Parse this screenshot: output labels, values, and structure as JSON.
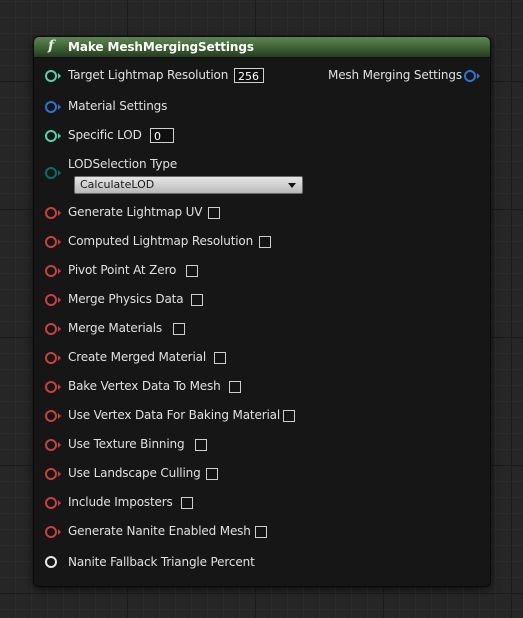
{
  "node": {
    "title": "Make MeshMergingSettings",
    "header_color": "#3d6034",
    "function_icon": "f"
  },
  "colors": {
    "int_pin": "#4fd6a8",
    "struct_pin": "#2d74d6",
    "byte_pin": "#0e6e63",
    "bool_pin": "#b23b3b",
    "float_pin": "#e8e8e8"
  },
  "inputs": {
    "target_lightmap_resolution": {
      "label": "Target Lightmap Resolution",
      "value": "256"
    },
    "material_settings": {
      "label": "Material Settings"
    },
    "specific_lod": {
      "label": "Specific LOD",
      "value": "0"
    },
    "lod_selection_type": {
      "label": "LODSelection Type",
      "selected": "CalculateLOD"
    },
    "bools": [
      {
        "label": "Generate Lightmap UV",
        "checked": false
      },
      {
        "label": "Computed Lightmap Resolution",
        "checked": false
      },
      {
        "label": "Pivot Point At Zero",
        "checked": false
      },
      {
        "label": "Merge Physics Data",
        "checked": false
      },
      {
        "label": "Merge Materials",
        "checked": false
      },
      {
        "label": "Create Merged Material",
        "checked": false
      },
      {
        "label": "Bake Vertex Data To Mesh",
        "checked": false
      },
      {
        "label": "Use Vertex Data For Baking Material",
        "checked": false
      },
      {
        "label": "Use Texture Binning",
        "checked": false
      },
      {
        "label": "Use Landscape Culling",
        "checked": false
      },
      {
        "label": "Include Imposters",
        "checked": false
      },
      {
        "label": "Generate Nanite Enabled Mesh",
        "checked": false
      }
    ],
    "nanite_fallback": {
      "label": "Nanite Fallback Triangle Percent"
    }
  },
  "outputs": {
    "mesh_merging_settings": {
      "label": "Mesh Merging Settings"
    }
  }
}
